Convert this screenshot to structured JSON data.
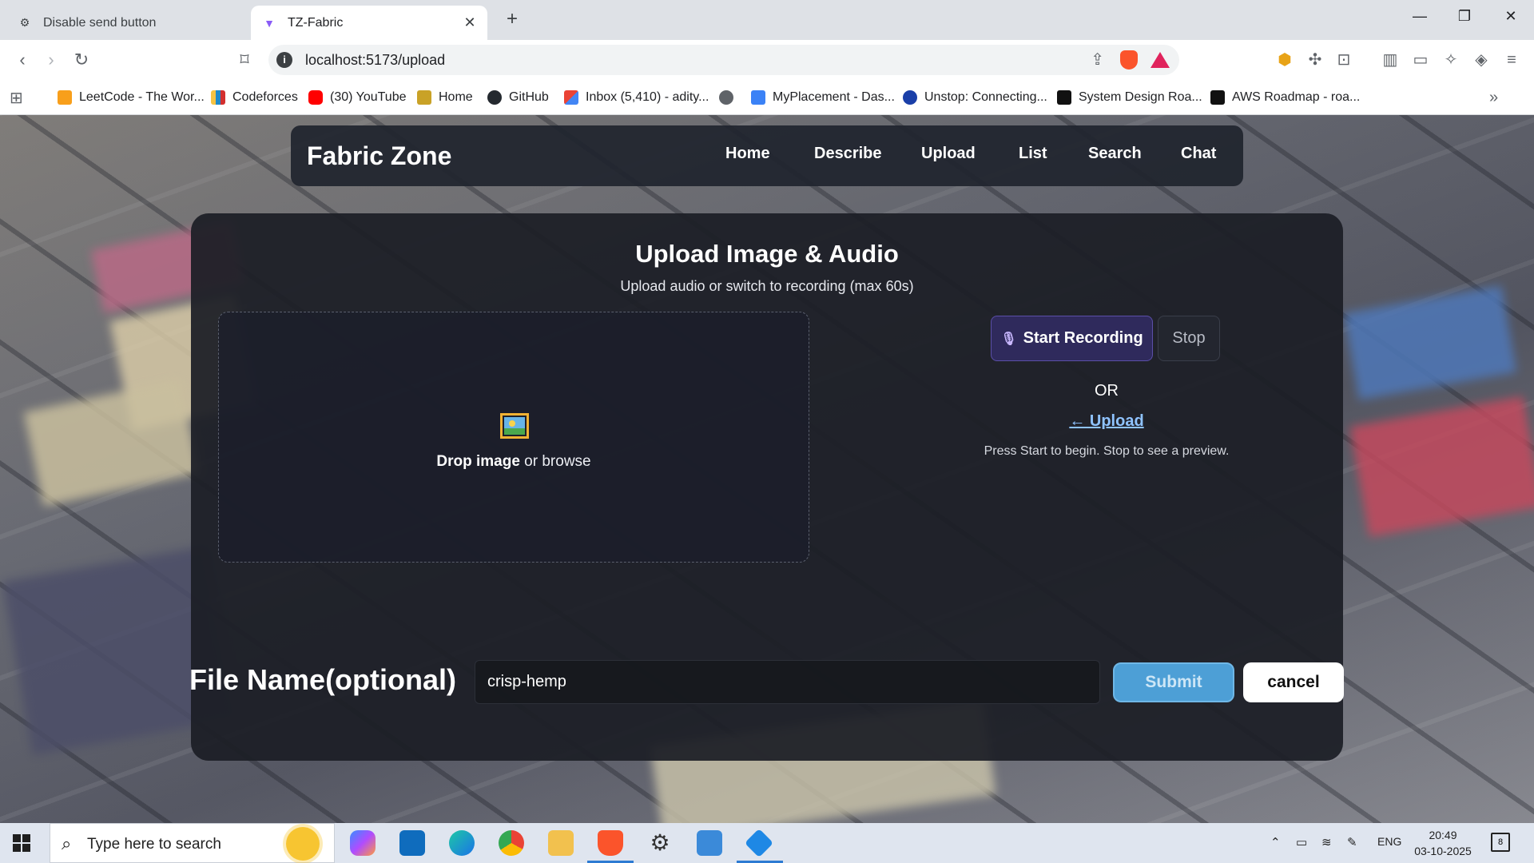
{
  "browser": {
    "tabs": [
      {
        "title": "Disable send button",
        "active": false
      },
      {
        "title": "TZ-Fabric",
        "active": true
      }
    ],
    "url": "localhost:5173/upload",
    "bookmarks": [
      {
        "label": "LeetCode - The Wor...",
        "color": "#f89f1b"
      },
      {
        "label": "Codeforces",
        "color": "#1f8acb"
      },
      {
        "label": "(30) YouTube",
        "color": "#ff0000"
      },
      {
        "label": "Home",
        "color": "#c9a227"
      },
      {
        "label": "GitHub",
        "color": "#24292f"
      },
      {
        "label": "Inbox (5,410) - adity...",
        "color": "#d93025"
      },
      {
        "label": "",
        "color": "#5f6368"
      },
      {
        "label": "MyPlacement - Das...",
        "color": "#3b82f6"
      },
      {
        "label": "Unstop: Connecting...",
        "color": "#1a3fa8"
      },
      {
        "label": "System Design Roa...",
        "color": "#111111"
      },
      {
        "label": "AWS Roadmap - roa...",
        "color": "#111111"
      }
    ]
  },
  "app": {
    "brand": "Fabric Zone",
    "nav": [
      "Home",
      "Describe",
      "Upload",
      "List",
      "Search",
      "Chat"
    ]
  },
  "upload": {
    "title": "Upload Image & Audio",
    "subtitle": "Upload audio or switch to recording (max 60s)",
    "drop_strong": "Drop image",
    "drop_rest": " or browse",
    "start_recording": "Start Recording",
    "stop": "Stop",
    "or": "OR",
    "upload_link": "← Upload",
    "hint": "Press Start to begin. Stop to see a preview."
  },
  "form": {
    "file_label": "File Name(optional)",
    "file_value": "crisp-hemp",
    "submit": "Submit",
    "cancel": "cancel"
  },
  "taskbar": {
    "search_placeholder": "Type here to search",
    "lang": "ENG",
    "time": "20:49",
    "date": "03-10-2025",
    "notifications": "8"
  }
}
